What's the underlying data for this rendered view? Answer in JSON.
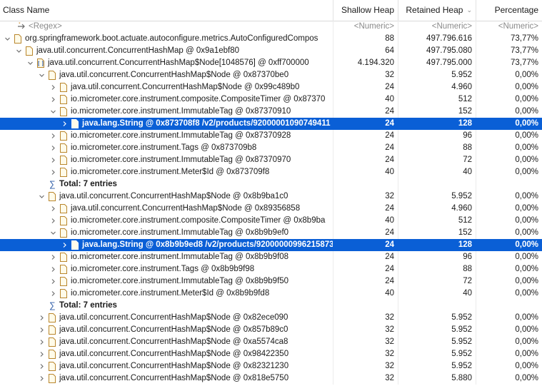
{
  "columns": {
    "class_name": "Class Name",
    "shallow_heap": "Shallow Heap",
    "retained_heap": "Retained Heap",
    "percentage": "Percentage"
  },
  "filter_row": {
    "regex": "<Regex>",
    "shallow": "<Numeric>",
    "retained": "<Numeric>",
    "percentage": "<Numeric>"
  },
  "rows": [
    {
      "label": "org.springframework.boot.actuate.autoconfigure.metrics.AutoConfiguredCompos",
      "shallow": "88",
      "retained": "497.796.616",
      "pct": "73,77%",
      "expander": "open"
    },
    {
      "label": "java.util.concurrent.ConcurrentHashMap @ 0x9a1ebf80",
      "shallow": "64",
      "retained": "497.795.080",
      "pct": "73,77%",
      "expander": "open"
    },
    {
      "label": "java.util.concurrent.ConcurrentHashMap$Node[1048576] @ 0xff700000",
      "shallow": "4.194.320",
      "retained": "497.795.000",
      "pct": "73,77%",
      "expander": "open"
    },
    {
      "label": "java.util.concurrent.ConcurrentHashMap$Node @ 0x87370be0",
      "shallow": "32",
      "retained": "5.952",
      "pct": "0,00%",
      "expander": "open"
    },
    {
      "label": "java.util.concurrent.ConcurrentHashMap$Node @ 0x99c489b0",
      "shallow": "24",
      "retained": "4.960",
      "pct": "0,00%",
      "expander": "closed"
    },
    {
      "label": "io.micrometer.core.instrument.composite.CompositeTimer @ 0x87370",
      "shallow": "40",
      "retained": "512",
      "pct": "0,00%",
      "expander": "closed"
    },
    {
      "label": "io.micrometer.core.instrument.ImmutableTag @ 0x87370910",
      "shallow": "24",
      "retained": "152",
      "pct": "0,00%",
      "expander": "open"
    },
    {
      "label": "java.lang.String @ 0x873708f8  /v2/products/92000001090749411",
      "shallow": "24",
      "retained": "128",
      "pct": "0,00%",
      "expander": "closed"
    },
    {
      "label": "io.micrometer.core.instrument.ImmutableTag @ 0x87370928",
      "shallow": "24",
      "retained": "96",
      "pct": "0,00%",
      "expander": "closed"
    },
    {
      "label": "io.micrometer.core.instrument.Tags @ 0x873709b8",
      "shallow": "24",
      "retained": "88",
      "pct": "0,00%",
      "expander": "closed"
    },
    {
      "label": "io.micrometer.core.instrument.ImmutableTag @ 0x87370970",
      "shallow": "24",
      "retained": "72",
      "pct": "0,00%",
      "expander": "closed"
    },
    {
      "label": "io.micrometer.core.instrument.Meter$Id @ 0x873709f8",
      "shallow": "40",
      "retained": "40",
      "pct": "0,00%",
      "expander": "closed"
    },
    {
      "label": "Total: 7 entries",
      "shallow": "",
      "retained": "",
      "pct": "",
      "expander": "none"
    },
    {
      "label": "java.util.concurrent.ConcurrentHashMap$Node @ 0x8b9ba1c0",
      "shallow": "32",
      "retained": "5.952",
      "pct": "0,00%",
      "expander": "open"
    },
    {
      "label": "java.util.concurrent.ConcurrentHashMap$Node @ 0x89356858",
      "shallow": "24",
      "retained": "4.960",
      "pct": "0,00%",
      "expander": "closed"
    },
    {
      "label": "io.micrometer.core.instrument.composite.CompositeTimer @ 0x8b9ba",
      "shallow": "40",
      "retained": "512",
      "pct": "0,00%",
      "expander": "closed"
    },
    {
      "label": "io.micrometer.core.instrument.ImmutableTag @ 0x8b9b9ef0",
      "shallow": "24",
      "retained": "152",
      "pct": "0,00%",
      "expander": "open"
    },
    {
      "label": "java.lang.String @ 0x8b9b9ed8  /v2/products/92000000996215873",
      "shallow": "24",
      "retained": "128",
      "pct": "0,00%",
      "expander": "closed"
    },
    {
      "label": "io.micrometer.core.instrument.ImmutableTag @ 0x8b9b9f08",
      "shallow": "24",
      "retained": "96",
      "pct": "0,00%",
      "expander": "closed"
    },
    {
      "label": "io.micrometer.core.instrument.Tags @ 0x8b9b9f98",
      "shallow": "24",
      "retained": "88",
      "pct": "0,00%",
      "expander": "closed"
    },
    {
      "label": "io.micrometer.core.instrument.ImmutableTag @ 0x8b9b9f50",
      "shallow": "24",
      "retained": "72",
      "pct": "0,00%",
      "expander": "closed"
    },
    {
      "label": "io.micrometer.core.instrument.Meter$Id @ 0x8b9b9fd8",
      "shallow": "40",
      "retained": "40",
      "pct": "0,00%",
      "expander": "closed"
    },
    {
      "label": "Total: 7 entries",
      "shallow": "",
      "retained": "",
      "pct": "",
      "expander": "none"
    },
    {
      "label": "java.util.concurrent.ConcurrentHashMap$Node @ 0x82ece090",
      "shallow": "32",
      "retained": "5.952",
      "pct": "0,00%",
      "expander": "closed"
    },
    {
      "label": "java.util.concurrent.ConcurrentHashMap$Node @ 0x857b89c0",
      "shallow": "32",
      "retained": "5.952",
      "pct": "0,00%",
      "expander": "closed"
    },
    {
      "label": "java.util.concurrent.ConcurrentHashMap$Node @ 0xa5574ca8",
      "shallow": "32",
      "retained": "5.952",
      "pct": "0,00%",
      "expander": "closed"
    },
    {
      "label": "java.util.concurrent.ConcurrentHashMap$Node @ 0x98422350",
      "shallow": "32",
      "retained": "5.952",
      "pct": "0,00%",
      "expander": "closed"
    },
    {
      "label": "java.util.concurrent.ConcurrentHashMap$Node @ 0x82321230",
      "shallow": "32",
      "retained": "5.952",
      "pct": "0,00%",
      "expander": "closed"
    },
    {
      "label": "java.util.concurrent.ConcurrentHashMap$Node @ 0x818e5750",
      "shallow": "32",
      "retained": "5.880",
      "pct": "0,00%",
      "expander": "closed"
    }
  ],
  "selection_color": "#0a5fd6"
}
